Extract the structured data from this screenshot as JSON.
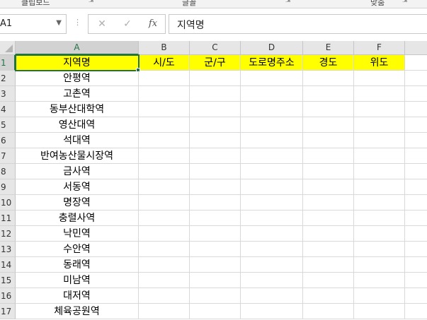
{
  "ribbon": {
    "groups": [
      "클립보드",
      "글꼴",
      "맞춤"
    ]
  },
  "formula_bar": {
    "name_box": "A1",
    "cancel_symbol": "✕",
    "enter_symbol": "✓",
    "fx_symbol": "fx",
    "formula": "지역명"
  },
  "columns": [
    "A",
    "B",
    "C",
    "D",
    "E",
    "F"
  ],
  "rows": [
    {
      "num": "1",
      "cells": [
        "지역명",
        "시/도",
        "군/구",
        "도로명주소",
        "경도",
        "위도"
      ]
    },
    {
      "num": "2",
      "cells": [
        "안평역",
        "",
        "",
        "",
        "",
        ""
      ]
    },
    {
      "num": "3",
      "cells": [
        "고촌역",
        "",
        "",
        "",
        "",
        ""
      ]
    },
    {
      "num": "4",
      "cells": [
        "동부산대학역",
        "",
        "",
        "",
        "",
        ""
      ]
    },
    {
      "num": "5",
      "cells": [
        "영산대역",
        "",
        "",
        "",
        "",
        ""
      ]
    },
    {
      "num": "6",
      "cells": [
        "석대역",
        "",
        "",
        "",
        "",
        ""
      ]
    },
    {
      "num": "7",
      "cells": [
        "반여농산물시장역",
        "",
        "",
        "",
        "",
        ""
      ]
    },
    {
      "num": "8",
      "cells": [
        "금사역",
        "",
        "",
        "",
        "",
        ""
      ]
    },
    {
      "num": "9",
      "cells": [
        "서동역",
        "",
        "",
        "",
        "",
        ""
      ]
    },
    {
      "num": "10",
      "cells": [
        "명장역",
        "",
        "",
        "",
        "",
        ""
      ]
    },
    {
      "num": "11",
      "cells": [
        "충렬사역",
        "",
        "",
        "",
        "",
        ""
      ]
    },
    {
      "num": "12",
      "cells": [
        "낙민역",
        "",
        "",
        "",
        "",
        ""
      ]
    },
    {
      "num": "13",
      "cells": [
        "수안역",
        "",
        "",
        "",
        "",
        ""
      ]
    },
    {
      "num": "14",
      "cells": [
        "동래역",
        "",
        "",
        "",
        "",
        ""
      ]
    },
    {
      "num": "15",
      "cells": [
        "미남역",
        "",
        "",
        "",
        "",
        ""
      ]
    },
    {
      "num": "16",
      "cells": [
        "대저역",
        "",
        "",
        "",
        "",
        ""
      ]
    },
    {
      "num": "17",
      "cells": [
        "체육공원역",
        "",
        "",
        "",
        "",
        ""
      ]
    }
  ],
  "colors": {
    "header_fill": "#ffff00",
    "selection": "#217346"
  }
}
